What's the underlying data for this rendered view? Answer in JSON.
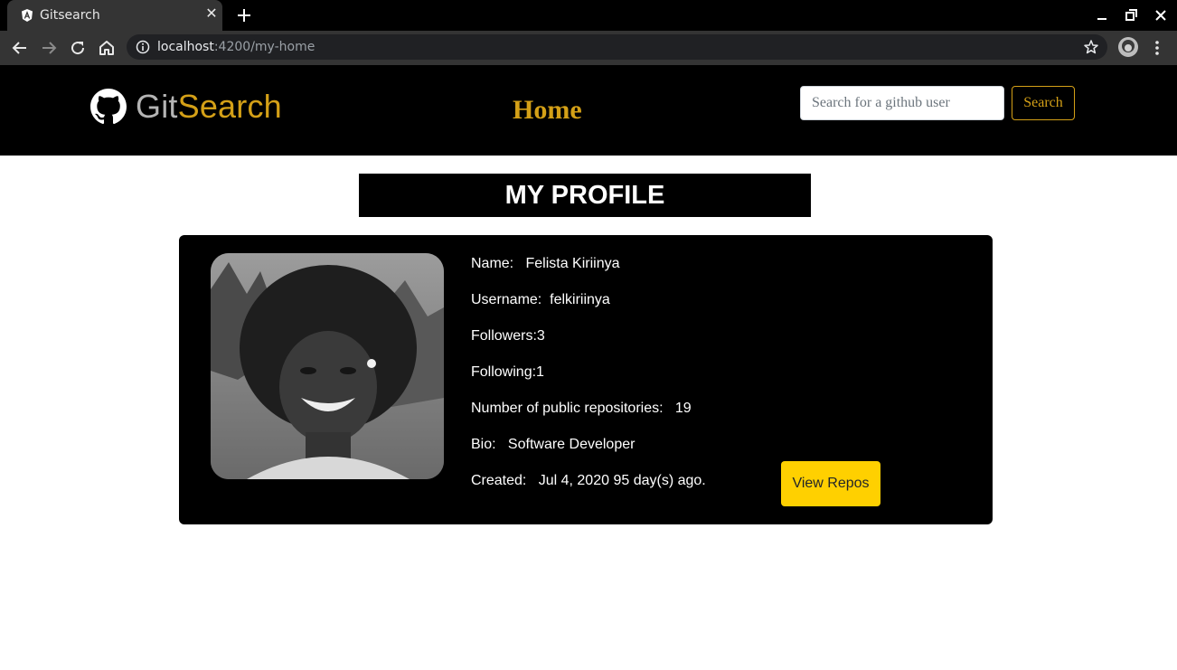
{
  "browser": {
    "tab_title": "Gitsearch",
    "url_host": "localhost",
    "url_path": ":4200/my-home"
  },
  "navbar": {
    "brand_part1": "Git",
    "brand_part2": "Search",
    "home_label": "Home",
    "search_placeholder": "Search for a github user",
    "search_button": "Search"
  },
  "profile": {
    "banner": "MY PROFILE",
    "name_label": "Name:",
    "name": "Felista Kiriinya",
    "username_label": "Username:",
    "username": "felkiriinya",
    "followers_label": "Followers:",
    "followers": "3",
    "following_label": "Following:",
    "following": "1",
    "repos_label": "Number of public repositories:",
    "repos": "19",
    "bio_label": "Bio:",
    "bio": "Software Developer",
    "created_label": "Created:",
    "created": "Jul 4, 2020 95 day(s) ago.",
    "view_repos_button": "View Repos"
  },
  "colors": {
    "accent": "#d4a017",
    "button_yellow": "#ffd000",
    "navbar_bg": "#000000"
  }
}
